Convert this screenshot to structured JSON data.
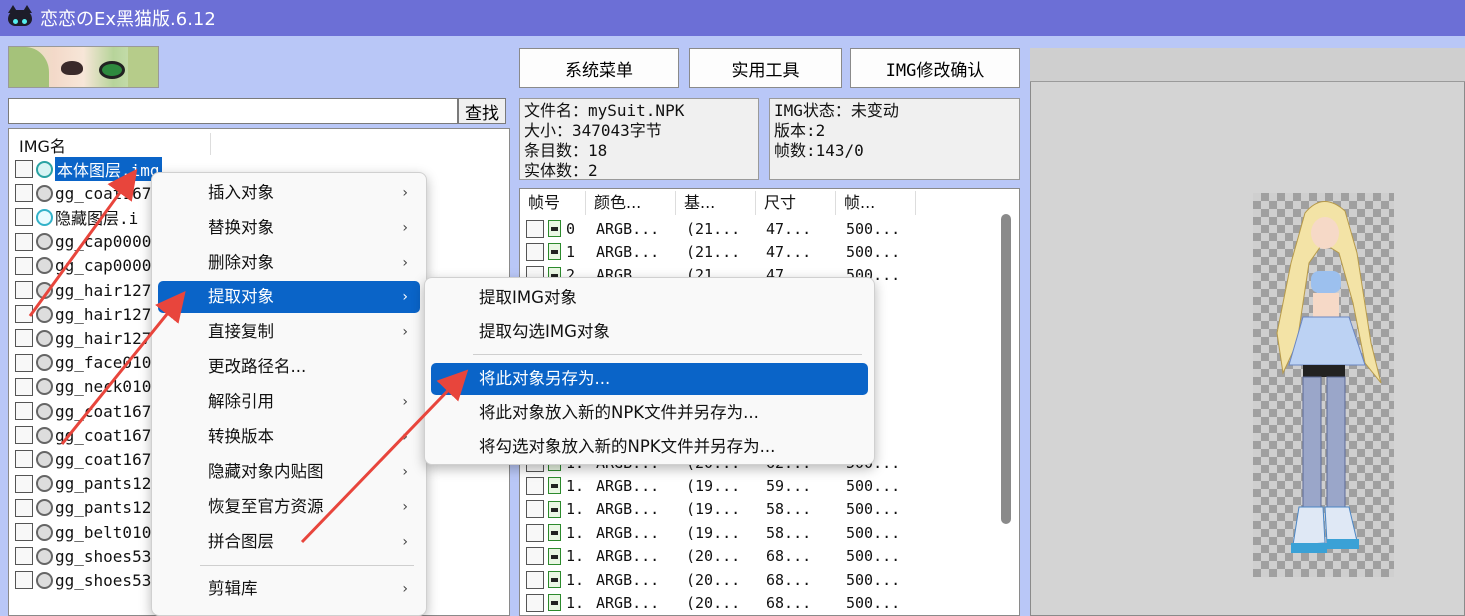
{
  "window": {
    "title": "恋恋のEx黑猫版.6.12"
  },
  "search": {
    "value": "",
    "button_label": "查找"
  },
  "img_list": {
    "header": "IMG名",
    "items": [
      {
        "label": "本体图层.img",
        "icon": "cat-icon-teal",
        "selected": true
      },
      {
        "label": "gg_coat167",
        "icon": "cat-icon"
      },
      {
        "label": "隐藏图层.i",
        "icon": "cat-icon-cyan"
      },
      {
        "label": "gg_cap0000",
        "icon": "cat-icon"
      },
      {
        "label": "gg_cap0000",
        "icon": "cat-icon"
      },
      {
        "label": "gg_hair127",
        "icon": "cat-icon"
      },
      {
        "label": "gg_hair127",
        "icon": "cat-icon"
      },
      {
        "label": "gg_hair127",
        "icon": "cat-icon"
      },
      {
        "label": "gg_face010",
        "icon": "cat-icon"
      },
      {
        "label": "gg_neck010",
        "icon": "cat-icon"
      },
      {
        "label": "gg_coat167",
        "icon": "cat-icon"
      },
      {
        "label": "gg_coat167",
        "icon": "cat-icon"
      },
      {
        "label": "gg_coat167",
        "icon": "cat-icon"
      },
      {
        "label": "gg_pants12",
        "icon": "cat-icon"
      },
      {
        "label": "gg_pants12",
        "icon": "cat-icon"
      },
      {
        "label": "gg_belt010",
        "icon": "cat-icon"
      },
      {
        "label": "gg_shoes53",
        "icon": "cat-icon"
      },
      {
        "label": "gg_shoes53",
        "icon": "cat-icon"
      }
    ]
  },
  "toolbar": {
    "system_menu": "系统菜单",
    "tools": "实用工具",
    "img_confirm": "IMG修改确认"
  },
  "file_info": {
    "line1": "文件名：mySuit.NPK",
    "line2": "大小：347043字节",
    "line3": "条目数：18",
    "line4": "实体数：2"
  },
  "img_info": {
    "line1": "IMG状态：未变动",
    "line2": "版本:2",
    "line3": "帧数:143/0"
  },
  "frames": {
    "headers": [
      "帧号",
      "颜色...",
      "基...",
      "尺寸",
      "帧..."
    ],
    "rows": [
      {
        "idx": "0",
        "color": "ARGB...",
        "base": "(21...",
        "size": "47...",
        "frame": "500..."
      },
      {
        "idx": "1",
        "color": "ARGB...",
        "base": "(21...",
        "size": "47...",
        "frame": "500..."
      },
      {
        "idx": "2",
        "color": "ARGB...",
        "base": "(21...",
        "size": "47...",
        "frame": "500..."
      },
      {
        "idx": "",
        "color": "",
        "base": "",
        "size": "",
        "frame": "..."
      },
      {
        "idx": "",
        "color": "",
        "base": "",
        "size": "",
        "frame": "..."
      },
      {
        "idx": "",
        "color": "",
        "base": "",
        "size": "",
        "frame": "..."
      },
      {
        "idx": "",
        "color": "",
        "base": "",
        "size": "",
        "frame": "..."
      },
      {
        "idx": "",
        "color": "",
        "base": "",
        "size": "",
        "frame": "..."
      },
      {
        "idx": "",
        "color": "",
        "base": "",
        "size": "",
        "frame": "..."
      },
      {
        "idx": "",
        "color": "",
        "base": "",
        "size": "",
        "frame": "..."
      },
      {
        "idx": "1.",
        "color": "ARGB...",
        "base": "(20...",
        "size": "62...",
        "frame": "500..."
      },
      {
        "idx": "1.",
        "color": "ARGB...",
        "base": "(19...",
        "size": "59...",
        "frame": "500..."
      },
      {
        "idx": "1.",
        "color": "ARGB...",
        "base": "(19...",
        "size": "58...",
        "frame": "500..."
      },
      {
        "idx": "1.",
        "color": "ARGB...",
        "base": "(19...",
        "size": "58...",
        "frame": "500..."
      },
      {
        "idx": "1.",
        "color": "ARGB...",
        "base": "(20...",
        "size": "68...",
        "frame": "500..."
      },
      {
        "idx": "1.",
        "color": "ARGB...",
        "base": "(20...",
        "size": "68...",
        "frame": "500..."
      },
      {
        "idx": "1.",
        "color": "ARGB...",
        "base": "(20...",
        "size": "68...",
        "frame": "500..."
      }
    ]
  },
  "context_menu": {
    "items": [
      {
        "label": "插入对象",
        "submenu": true
      },
      {
        "label": "替换对象",
        "submenu": true
      },
      {
        "label": "删除对象",
        "submenu": true
      },
      {
        "label": "提取对象",
        "submenu": true,
        "active": true
      },
      {
        "label": "直接复制",
        "submenu": true
      },
      {
        "label": "更改路径名...",
        "submenu": false
      },
      {
        "label": "解除引用",
        "submenu": true
      },
      {
        "label": "转换版本",
        "submenu": true
      },
      {
        "label": "隐藏对象内贴图",
        "submenu": true
      },
      {
        "label": "恢复至官方资源",
        "submenu": true
      },
      {
        "label": "拼合图层",
        "submenu": true
      },
      {
        "label": "剪辑库",
        "submenu": true
      }
    ],
    "arrow_glyph": "›"
  },
  "submenu": {
    "items": [
      {
        "label": "提取IMG对象"
      },
      {
        "label": "提取勾选IMG对象"
      },
      {
        "label": "将此对象另存为...",
        "active": true
      },
      {
        "label": "将此对象放入新的NPK文件并另存为..."
      },
      {
        "label": "将勾选对象放入新的NPK文件并另存为..."
      }
    ]
  },
  "colors": {
    "accent": "#0a64c8",
    "titlebar": "#6c6fd6",
    "background": "#b9c7f7",
    "annotation": "#e8453c"
  }
}
